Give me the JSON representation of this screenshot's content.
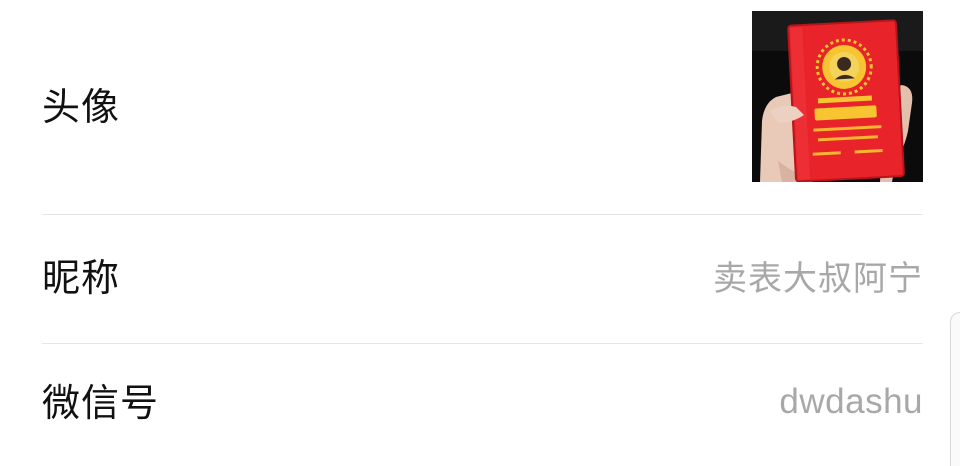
{
  "profile": {
    "avatar": {
      "label": "头像",
      "image_desc_icon": "red-book-photo-icon"
    },
    "nickname": {
      "label": "昵称",
      "value": "卖表大叔阿宁"
    },
    "wechat_id": {
      "label": "微信号",
      "value": "dwdashu"
    }
  },
  "colors": {
    "label": "#111111",
    "value": "#a8a8a8",
    "divider": "#e6e6e6",
    "book_red": "#e8232a"
  }
}
